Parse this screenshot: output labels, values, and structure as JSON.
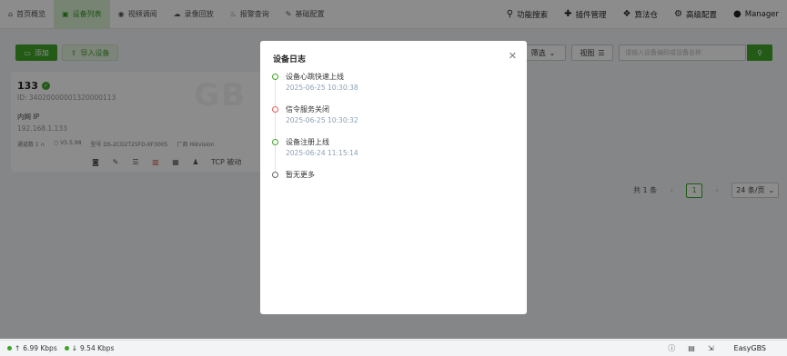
{
  "nav": {
    "left": [
      {
        "icon": "home-icon",
        "glyph": "⌂",
        "label": "首页概览",
        "active": false
      },
      {
        "icon": "video-icon",
        "glyph": "▣",
        "label": "设备列表",
        "active": true
      },
      {
        "icon": "play-icon",
        "glyph": "◉",
        "label": "视频调阅",
        "active": false
      },
      {
        "icon": "cloud-icon",
        "glyph": "☁",
        "label": "录像回放",
        "active": false
      },
      {
        "icon": "alarm-icon",
        "glyph": "♨",
        "label": "报警查询",
        "active": false
      },
      {
        "icon": "config-icon",
        "glyph": "✎",
        "label": "基础配置",
        "active": false
      }
    ],
    "right": [
      {
        "icon": "search-icon",
        "glyph": "🔍",
        "label": "功能搜索"
      },
      {
        "icon": "puzzle-icon",
        "glyph": "✚",
        "label": "插件管理"
      },
      {
        "icon": "dropbox-icon",
        "glyph": "❖",
        "label": "算法仓"
      },
      {
        "icon": "gear-icon",
        "glyph": "⚙",
        "label": "高级配置"
      },
      {
        "icon": "user-icon",
        "glyph": "👤",
        "label": "Manager"
      }
    ]
  },
  "toolbar": {
    "add_label": "添加",
    "import_label": "导入设备",
    "filter_label": "筛选",
    "view_label": "视图",
    "search_placeholder": "请输入设备编码或设备名称"
  },
  "device": {
    "name": "133",
    "id": "ID: 34020000001320000113",
    "net_label": "内网 IP",
    "ip": "192.168.1.133",
    "channels": "通道数 1",
    "version": "V5.5.98",
    "model": "型号 DS-2CD2T25FD-XF3005",
    "vendor": "厂商 Hikvision",
    "watermark": "GB",
    "transport": "TCP 被动"
  },
  "pagination": {
    "total": "共 1 条",
    "current": "1",
    "page_size": "24 条/页"
  },
  "modal": {
    "title": "设备日志",
    "entries": [
      {
        "text": "设备心跳快速上线",
        "time": "2025-06-25 10:30:38",
        "status": "green"
      },
      {
        "text": "信令服务关闭",
        "time": "2025-06-25 10:30:32",
        "status": "red"
      },
      {
        "text": "设备注册上线",
        "time": "2025-06-24 11:15:14",
        "status": "green"
      }
    ],
    "no_more": "暂无更多"
  },
  "status": {
    "upload": "6.99 Kbps",
    "download": "9.54 Kbps",
    "brand": "EasyGBS"
  },
  "colors": {
    "accent": "#3ea428",
    "danger": "#e55b5b"
  }
}
